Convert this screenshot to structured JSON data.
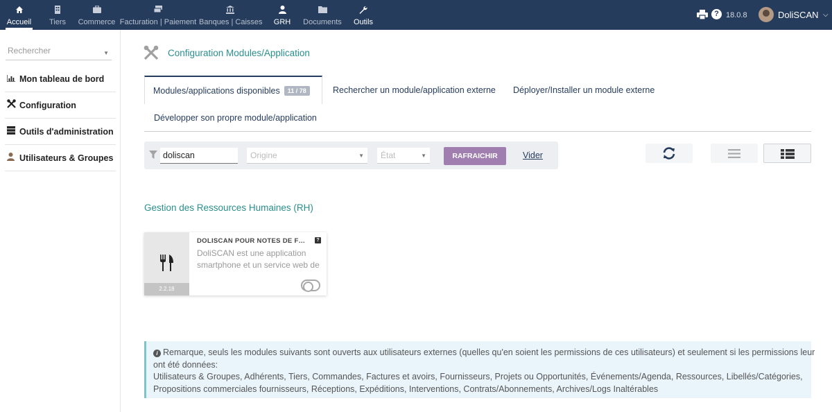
{
  "menu": [
    {
      "label": "Accueil",
      "icon": "home-icon"
    },
    {
      "label": "Tiers",
      "icon": "building-icon"
    },
    {
      "label": "Commerce",
      "icon": "briefcase-icon"
    },
    {
      "label": "Facturation | Paiement",
      "icon": "money-icon"
    },
    {
      "label": "Banques | Caisses",
      "icon": "bank-icon"
    },
    {
      "label": "GRH",
      "icon": "user-icon"
    },
    {
      "label": "Documents",
      "icon": "folder-icon"
    },
    {
      "label": "Outils",
      "icon": "wrench-icon"
    }
  ],
  "topbar": {
    "version": "18.0.8",
    "username": "DoliSCAN"
  },
  "sidebar": {
    "search_placeholder": "Rechercher",
    "items": [
      {
        "label": "Mon tableau de bord",
        "icon": "chart-icon"
      },
      {
        "label": "Configuration",
        "icon": "tools-icon"
      },
      {
        "label": "Outils d'administration",
        "icon": "server-icon"
      },
      {
        "label": "Utilisateurs & Groupes",
        "icon": "user-icon"
      }
    ]
  },
  "main": {
    "title": "Configuration Modules/Application",
    "tabs": [
      {
        "label": "Modules/applications disponibles",
        "badge": "11 / 78"
      },
      {
        "label": "Rechercher un module/application externe"
      },
      {
        "label": "Déployer/Installer un module externe"
      },
      {
        "label": "Développer son propre module/application"
      }
    ],
    "filter": {
      "search_value": "doliscan",
      "origin_placeholder": "Origine",
      "state_placeholder": "État",
      "refresh_label": "RAFRAICHIR",
      "clear_label": "Vider"
    },
    "section_title": "Gestion des Ressources Humaines (RH)",
    "module": {
      "title": "DOLISCAN POUR NOTES DE FRAIS",
      "description_line1": "DoliSCAN est une application",
      "description_line2": "smartphone et un service web de",
      "version": "2.2.18"
    },
    "note": {
      "line1": "Remarque, seuls les modules suivants sont ouverts aux utilisateurs externes (quelles qu'en soient les permissions de ces utilisateurs) et seulement si les permissions leur",
      "line2": "ont été données:",
      "line3": "Utilisateurs & Groupes, Adhérents, Tiers, Commandes, Factures et avoirs, Fournisseurs, Projets ou Opportunités, Événements/Agenda, Ressources, Libellés/Catégories,",
      "line4": "Propositions commerciales fournisseurs, Réceptions, Expéditions, Interventions, Contrats/Abonnements, Archives/Logs Inaltérables"
    }
  },
  "colors": {
    "topbar": "#263c5c",
    "accent_teal": "#2a8f8c",
    "button_purple": "#a07fb0"
  }
}
